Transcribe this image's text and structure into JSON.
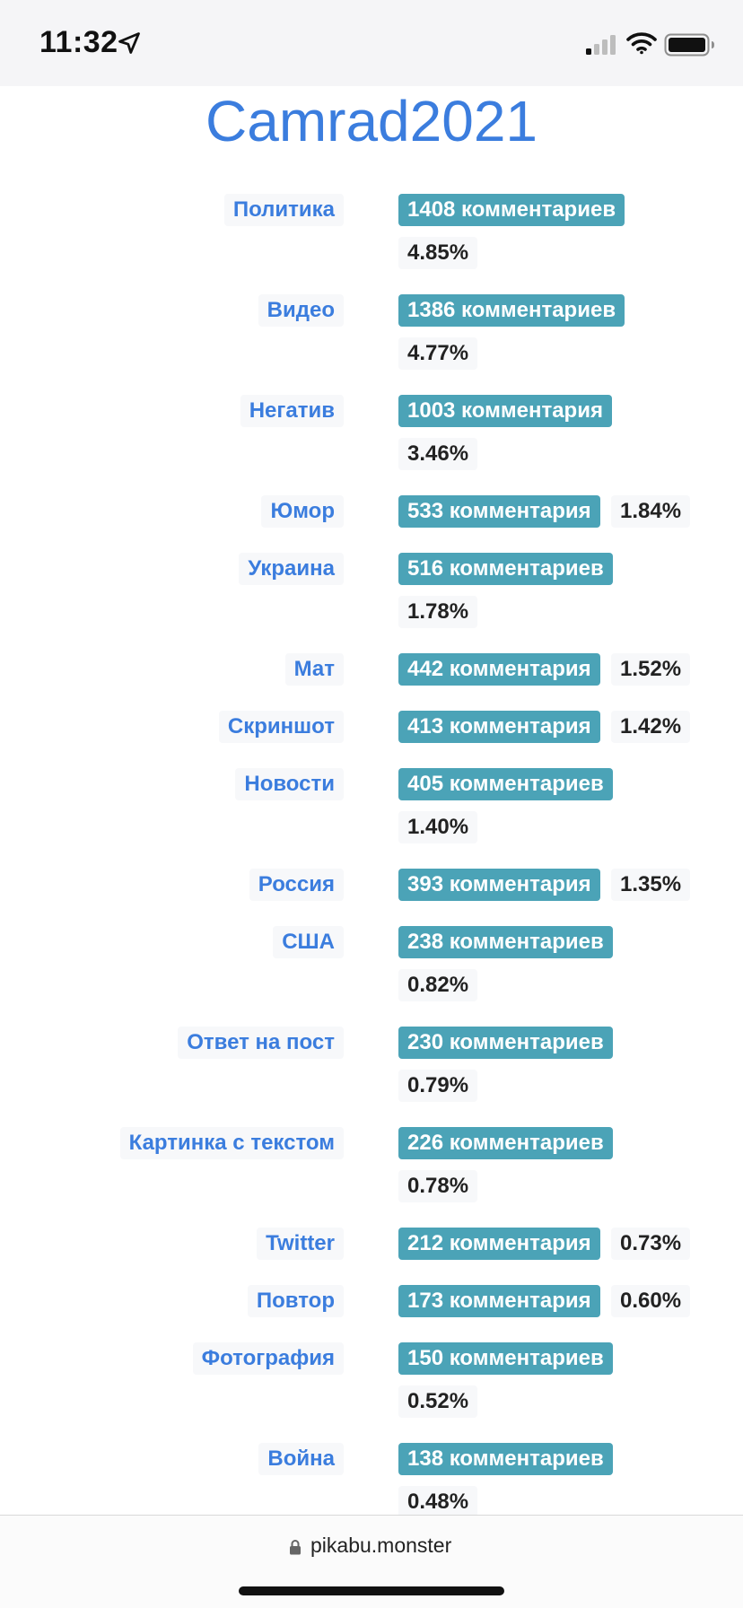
{
  "status_bar": {
    "time": "11:32"
  },
  "page": {
    "title": "Camrad2021"
  },
  "colors": {
    "title": "#3b7dde",
    "tag_text": "#3b7dde",
    "count_bg": "#4ba3b7",
    "pct_bg": "#f7f8fa"
  },
  "rows": [
    {
      "tag": "Политика",
      "count": "1408 комментариев",
      "pct": "4.85%"
    },
    {
      "tag": "Видео",
      "count": "1386 комментариев",
      "pct": "4.77%"
    },
    {
      "tag": "Негатив",
      "count": "1003 комментария",
      "pct": "3.46%"
    },
    {
      "tag": "Юмор",
      "count": "533 комментария",
      "pct": "1.84%"
    },
    {
      "tag": "Украина",
      "count": "516 комментариев",
      "pct": "1.78%"
    },
    {
      "tag": "Мат",
      "count": "442 комментария",
      "pct": "1.52%"
    },
    {
      "tag": "Скриншот",
      "count": "413 комментария",
      "pct": "1.42%"
    },
    {
      "tag": "Новости",
      "count": "405 комментариев",
      "pct": "1.40%"
    },
    {
      "tag": "Россия",
      "count": "393 комментария",
      "pct": "1.35%"
    },
    {
      "tag": "США",
      "count": "238 комментариев",
      "pct": "0.82%"
    },
    {
      "tag": "Ответ на пост",
      "count": "230 комментариев",
      "pct": "0.79%"
    },
    {
      "tag": "Картинка с текстом",
      "count": "226 комментариев",
      "pct": "0.78%"
    },
    {
      "tag": "Twitter",
      "count": "212 комментария",
      "pct": "0.73%"
    },
    {
      "tag": "Повтор",
      "count": "173 комментария",
      "pct": "0.60%"
    },
    {
      "tag": "Фотография",
      "count": "150 комментариев",
      "pct": "0.52%"
    },
    {
      "tag": "Война",
      "count": "138 комментариев",
      "pct": "0.48%"
    }
  ],
  "address_bar": {
    "url": "pikabu.monster"
  }
}
